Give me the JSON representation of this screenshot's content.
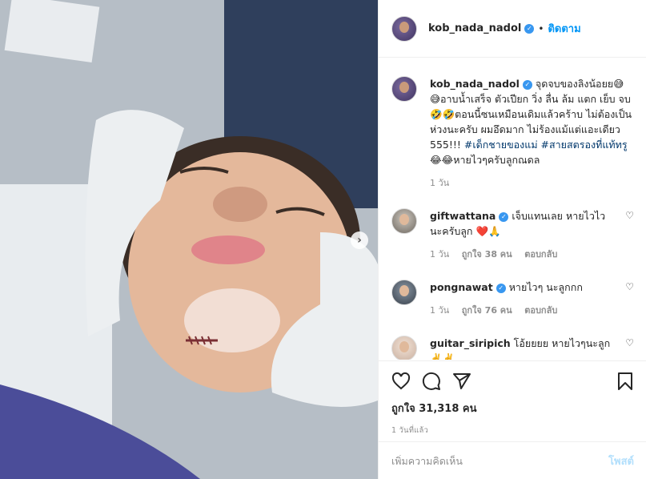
{
  "post": {
    "author": "kob_nada_nadol",
    "follow_label": "ติดตาม",
    "dot": "•"
  },
  "caption": {
    "username": "kob_nada_nadol",
    "text_1": "จุดจบของลิงน้อยย😅😅อาบน้ำเสร็จ ตัวเปียก วิ่ง ลื่น ล้ม แตก เย็บ จบ🤣🤣ตอนนี้ซนเหมือนเดิมแล้วคร้าบ ไม่ต้องเป็นห่วงนะครับ ผมอึดมาก ไม่ร้องแม้แต่แอะเดียว 555!!! ",
    "hashtags": "#เด็กชายของแม่ #สายสตรองที่แท้ทรู",
    "text_2": " 😂😂หายไวๆครับลูกณดล",
    "time": "1 วัน"
  },
  "comments": [
    {
      "username": "giftwattana",
      "verified": true,
      "text": "เจ็บแทนเลย หายไวไวนะครับลูก ❤️🙏",
      "time": "1 วัน",
      "likes": "ถูกใจ 38 คน",
      "reply": "ตอบกลับ"
    },
    {
      "username": "pongnawat",
      "verified": true,
      "text": "หายไวๆ นะลูกกก",
      "time": "1 วัน",
      "likes": "ถูกใจ 76 คน",
      "reply": "ตอบกลับ"
    },
    {
      "username": "guitar_siripich",
      "verified": false,
      "text": "โอ้ยยยย หายไวๆนะลูก✌️✌️",
      "time": "",
      "likes": "",
      "reply": ""
    }
  ],
  "actions": {
    "likes": "ถูกใจ 31,318 คน",
    "posted": "1 วันที่แล้ว"
  },
  "add_comment": {
    "placeholder": "เพิ่มความคิดเห็น",
    "post_label": "โพสต์"
  },
  "icons": [
    "verified-badge-icon",
    "heart-icon",
    "comment-icon",
    "share-icon",
    "bookmark-icon",
    "chevron-right-icon"
  ],
  "colors": {
    "accent": "#0095f6",
    "verified": "#3897f0",
    "post_disabled": "#b2dffc",
    "muted": "#8e8e8e"
  }
}
